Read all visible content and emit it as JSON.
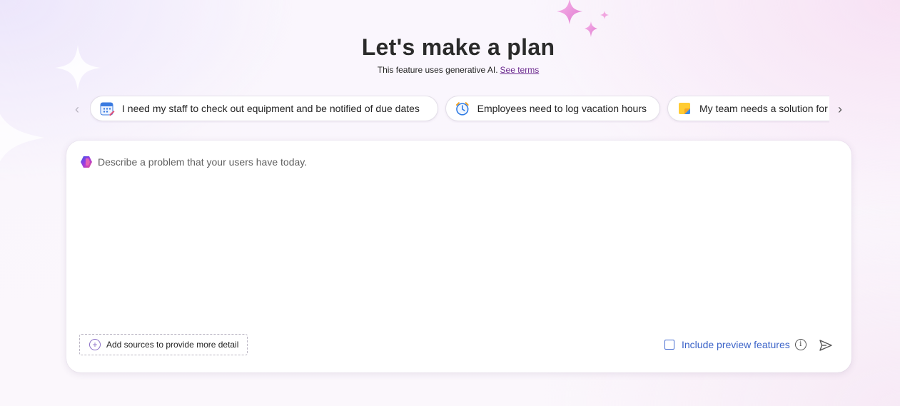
{
  "header": {
    "title": "Let's make a plan",
    "subtitle": "This feature uses generative AI.",
    "terms_link": "See terms"
  },
  "suggestions": {
    "items": [
      {
        "label": "I need my staff to check out equipment and be notified of due dates",
        "icon": "calendar-icon"
      },
      {
        "label": "Employees need to log vacation hours",
        "icon": "alarm-clock-icon"
      },
      {
        "label": "My team needs a solution for",
        "icon": "sticky-note-icon"
      }
    ],
    "prev_icon": "chevron-left-icon",
    "next_icon": "chevron-right-icon"
  },
  "composer": {
    "placeholder": "Describe a problem that your users have today.",
    "add_sources_label": "Add sources to provide more detail",
    "include_preview_label": "Include preview features",
    "include_preview_checked": false
  },
  "colors": {
    "link": "#6b2a8f",
    "accent_blue": "#3b63c8",
    "sparkle_pink": "#e98ad3"
  }
}
